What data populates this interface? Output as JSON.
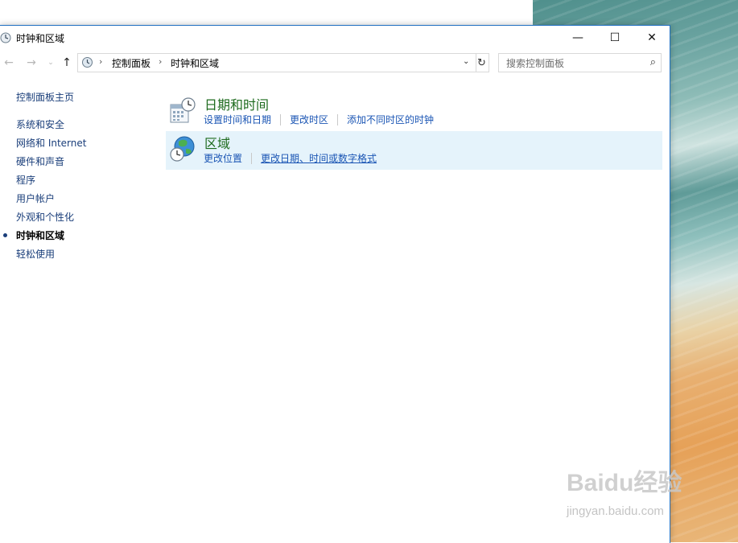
{
  "window": {
    "title": "时钟和区域",
    "controls": {
      "minimize": "—",
      "maximize": "☐",
      "close": "✕"
    }
  },
  "nav": {
    "back_icon": "arrow-left-icon",
    "forward_icon": "arrow-right-icon",
    "up_icon": "arrow-up-icon",
    "back": "←",
    "forward": "→",
    "dropdown": "⌄",
    "up": "↑"
  },
  "address": {
    "sep": "›",
    "crumbs": [
      "控制面板",
      "时钟和区域"
    ],
    "chevron": "⌄",
    "refresh": "↻"
  },
  "search": {
    "placeholder": "搜索控制面板",
    "icon": "⌕"
  },
  "sidebar": {
    "home": "控制面板主页",
    "items": [
      {
        "label": "系统和安全",
        "active": false
      },
      {
        "label": "网络和 Internet",
        "active": false
      },
      {
        "label": "硬件和声音",
        "active": false
      },
      {
        "label": "程序",
        "active": false
      },
      {
        "label": "用户帐户",
        "active": false
      },
      {
        "label": "外观和个性化",
        "active": false
      },
      {
        "label": "时钟和区域",
        "active": true
      },
      {
        "label": "轻松使用",
        "active": false
      }
    ]
  },
  "categories": [
    {
      "title": "日期和时间",
      "icon": "calendar-clock-icon",
      "links": [
        "设置时间和日期",
        "更改时区",
        "添加不同时区的时钟"
      ]
    },
    {
      "title": "区域",
      "icon": "globe-clock-icon",
      "links": [
        "更改位置",
        "更改日期、时间或数字格式"
      ]
    }
  ],
  "watermark": {
    "main": "Baidu经验",
    "sub": "jingyan.baidu.com"
  },
  "colors": {
    "link": "#1a55b4",
    "category_title": "#1e6b1e",
    "selected_bg": "#e5f3fb",
    "window_border": "#1e6fc1"
  }
}
